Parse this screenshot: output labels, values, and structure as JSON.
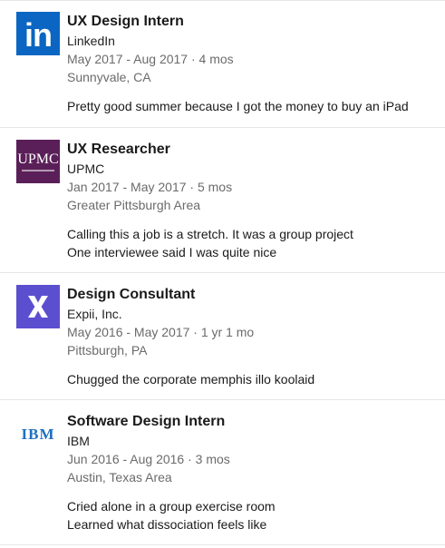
{
  "experiences": [
    {
      "logo_icon": "linkedin-logo-icon",
      "logo_text": "in",
      "title": "UX Design Intern",
      "company": "LinkedIn",
      "dates": "May 2017 - Aug 2017 · 4 mos",
      "location": "Sunnyvale, CA",
      "description": [
        "Pretty good summer because I got the money to buy an iPad"
      ]
    },
    {
      "logo_icon": "upmc-logo-icon",
      "logo_text": "UPMC",
      "title": "UX Researcher",
      "company": "UPMC",
      "dates": "Jan 2017 - May 2017 · 5 mos",
      "location": "Greater Pittsburgh Area",
      "description": [
        "Calling this a job is a stretch. It was a group project",
        "One interviewee said I was quite nice"
      ]
    },
    {
      "logo_icon": "expii-logo-icon",
      "logo_text": "",
      "title": "Design Consultant",
      "company": "Expii, Inc.",
      "dates": "May 2016 - May 2017 · 1 yr 1 mo",
      "location": "Pittsburgh, PA",
      "description": [
        "Chugged the corporate memphis illo koolaid"
      ]
    },
    {
      "logo_icon": "ibm-logo-icon",
      "logo_text": "IBM",
      "title": "Software Design Intern",
      "company": "IBM",
      "dates": "Jun 2016 - Aug 2016 · 3 mos",
      "location": "Austin, Texas Area",
      "description": [
        "Cried alone in a group exercise room",
        "Learned what dissociation feels like"
      ]
    }
  ],
  "colors": {
    "linkedin_blue": "#0a66c2",
    "upmc_purple": "#5a1f58",
    "expii_purple": "#5b4fd0",
    "ibm_blue": "#1f70c1",
    "meta_gray": "#6b6b6b",
    "divider": "#e6e6e6"
  }
}
